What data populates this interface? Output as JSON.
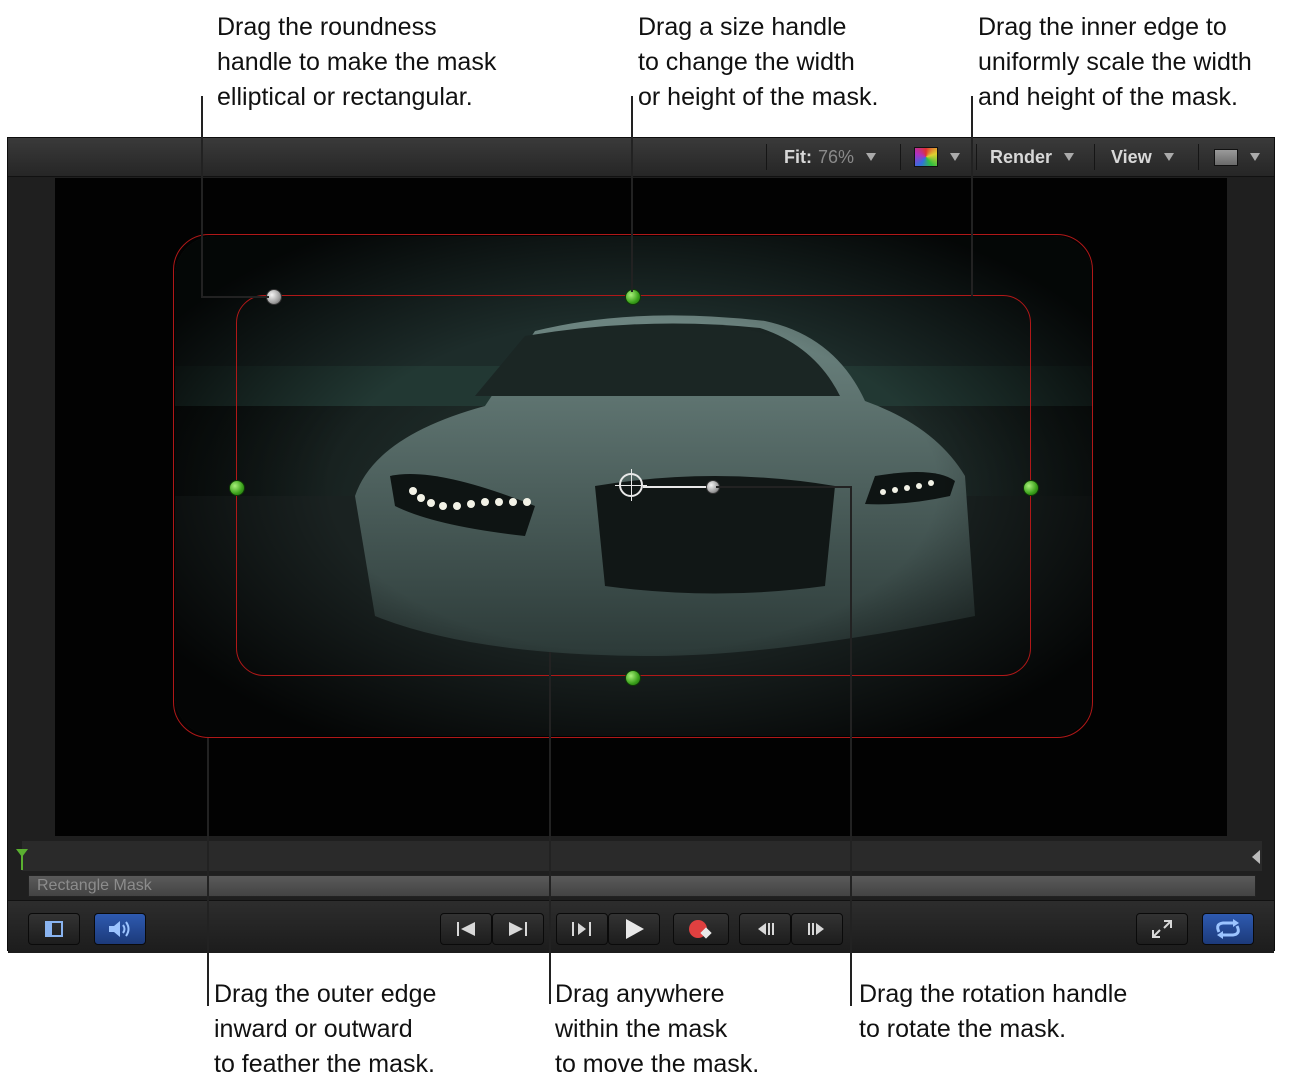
{
  "callouts": {
    "roundness": "Drag the roundness\nhandle to make the mask\nelliptical or rectangular.",
    "size": "Drag a size handle\nto change the width\nor height of the mask.",
    "inner_edge": "Drag the inner edge to\nuniformly scale the width\nand height of the mask.",
    "outer_edge": "Drag the outer edge\ninward or outward\nto feather the mask.",
    "move": "Drag anywhere\nwithin the mask\nto move the mask.",
    "rotation": "Drag the rotation handle\nto rotate the mask."
  },
  "toolbar": {
    "fit_label": "Fit:",
    "fit_value": "76%",
    "render_label": "Render",
    "view_label": "View"
  },
  "timeline": {
    "track_label": "Rectangle Mask"
  },
  "icons": {
    "channels": "color-channels-icon",
    "layout": "layout-icon",
    "audio": "speaker-icon",
    "go_start": "go-to-start-icon",
    "go_end": "go-to-end-icon",
    "play_from_start": "play-from-start-icon",
    "play": "play-icon",
    "record": "record-icon",
    "prev_frame": "previous-frame-icon",
    "next_frame": "next-frame-icon",
    "fullscreen": "fullscreen-icon",
    "loop": "loop-icon"
  },
  "colors": {
    "mask_edge": "#b01818",
    "handle": "#3aa01a",
    "active_button": "#2e5ab0"
  }
}
